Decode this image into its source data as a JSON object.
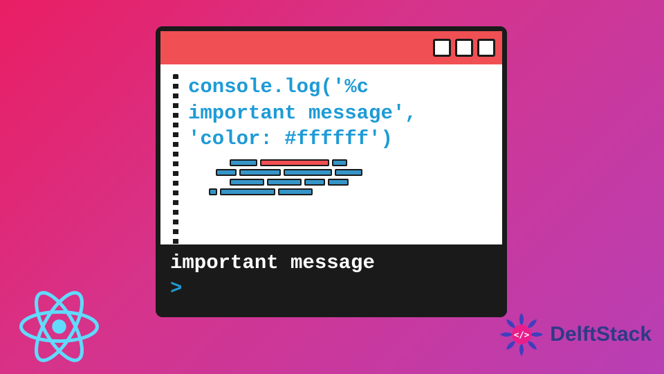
{
  "window": {
    "code_line1": "console.log('%c",
    "code_line2": "important message',",
    "code_line3": "'color: #ffffff')",
    "console_output": "important message",
    "prompt": ">"
  },
  "brand": {
    "name": "DelftStack"
  },
  "colors": {
    "titlebar": "#f05053",
    "code_text": "#1e9bd6",
    "console_bg": "#1a1a1a",
    "react_icon": "#61dafb",
    "delft_ornament": "#3b3fbf"
  }
}
